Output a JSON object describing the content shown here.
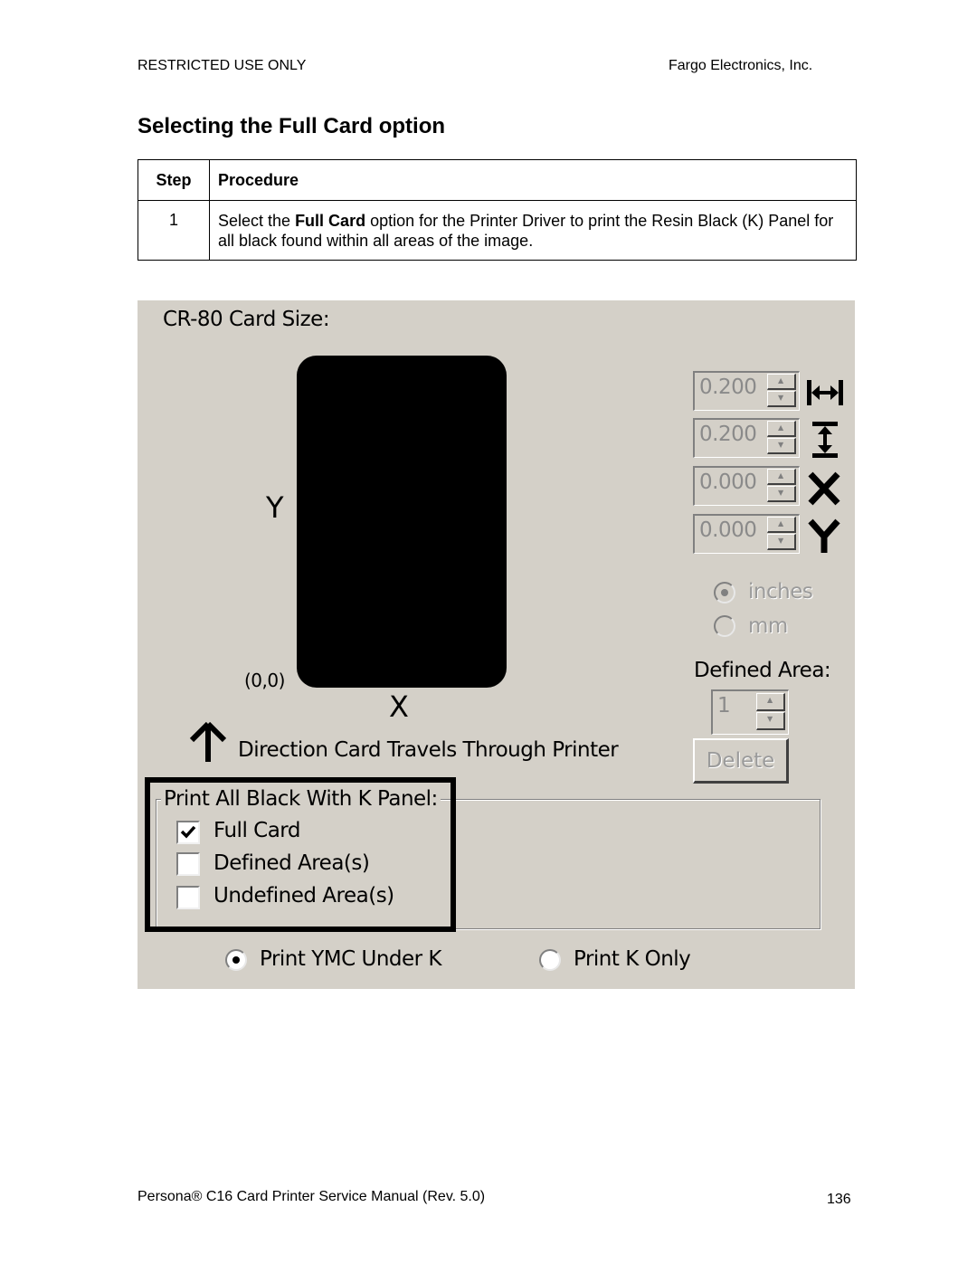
{
  "header": {
    "left": "RESTRICTED USE ONLY",
    "right": "Fargo Electronics, Inc."
  },
  "title": "Selecting the Full Card option",
  "procedure_table": {
    "headers": [
      "Step",
      "Procedure"
    ],
    "rows": [
      {
        "step": "1",
        "text_before": "Select the ",
        "text_bold": "Full Card",
        "text_after": " option for the Printer Driver to print the Resin Black (K) Panel for all black found within all areas of the image."
      }
    ]
  },
  "dialog": {
    "card_size_label": "CR-80 Card Size:",
    "card_preview_color": "#000000",
    "axis_y_label": "Y",
    "axis_x_label": "X",
    "origin_label": "(0,0)",
    "direction_label": "Direction Card Travels Through Printer",
    "direction_icon": "arrow-up-icon",
    "fields": {
      "width": {
        "value": "0.200",
        "icon": "width-arrows-icon",
        "enabled": false
      },
      "height": {
        "value": "0.200",
        "icon": "height-arrows-icon",
        "enabled": false
      },
      "x": {
        "value": "0.000",
        "icon": "x-letter-icon",
        "icon_text": "X",
        "enabled": false
      },
      "y": {
        "value": "0.000",
        "icon": "y-letter-icon",
        "icon_text": "Y",
        "enabled": false
      }
    },
    "units": {
      "options": [
        "inches",
        "mm"
      ],
      "selected": "inches",
      "enabled": false
    },
    "defined_area": {
      "label": "Defined Area:",
      "value": "1",
      "enabled": false
    },
    "delete_button": {
      "label": "Delete",
      "enabled": false
    },
    "k_panel_group": {
      "label": "Print All Black With K Panel:",
      "options": [
        {
          "label": "Full Card",
          "checked": true
        },
        {
          "label": "Defined Area(s)",
          "checked": false
        },
        {
          "label": "Undefined Area(s)",
          "checked": false
        }
      ],
      "highlighted": true
    },
    "print_mode": {
      "options": [
        "Print YMC Under K",
        "Print K Only"
      ],
      "selected": "Print YMC Under K"
    },
    "background_color": "#d4d0c8"
  },
  "footer": {
    "left": "Persona® C16 Card Printer Service Manual (Rev. 5.0)",
    "page_number": "136"
  }
}
